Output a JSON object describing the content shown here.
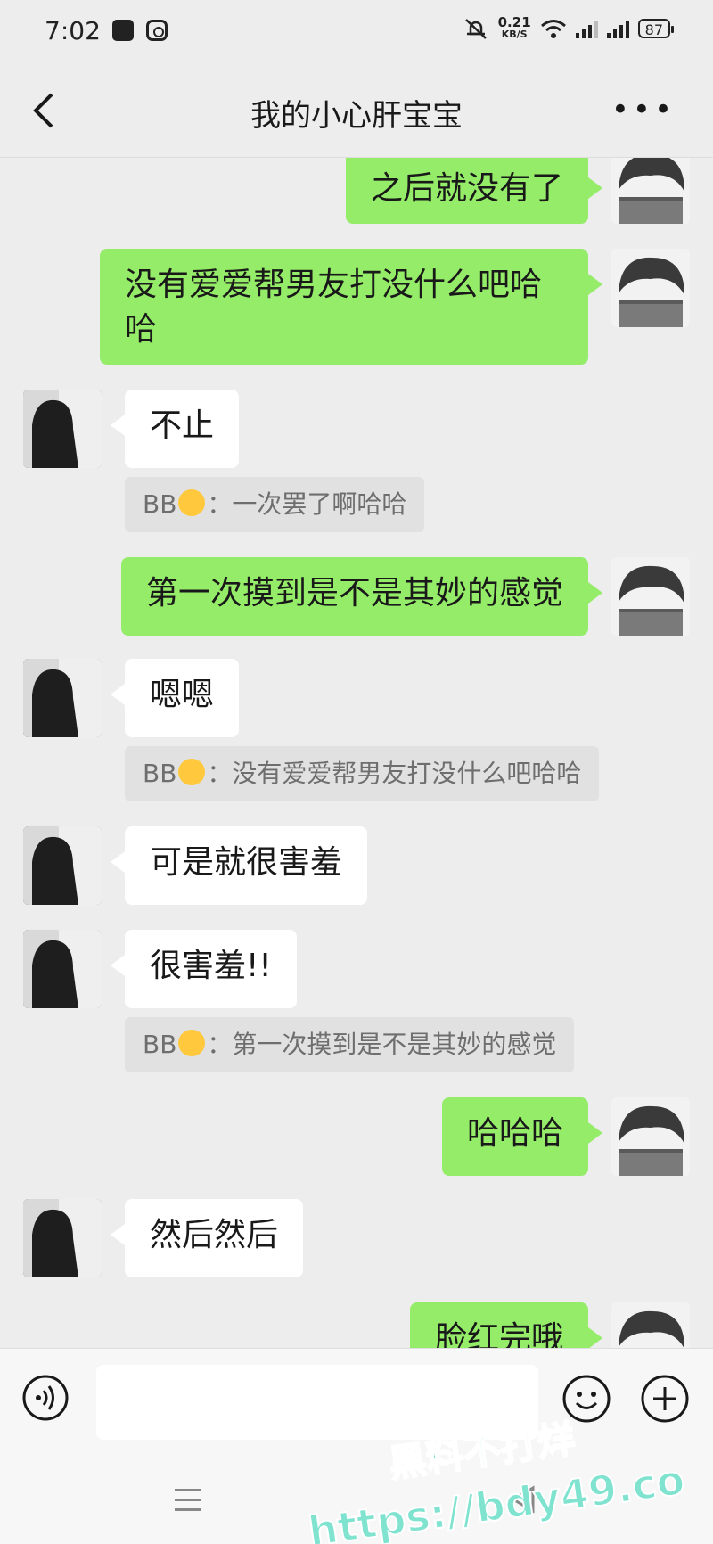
{
  "status_bar": {
    "time": "7:02",
    "net_speed": "0.21",
    "net_unit": "KB/S",
    "battery": "87"
  },
  "header": {
    "title": "我的小心肝宝宝"
  },
  "messages": [
    {
      "side": "me",
      "text": "之后就没有了"
    },
    {
      "side": "me",
      "text_line1": "没有爱爱帮男友打没什么吧哈",
      "text_line2": "哈"
    },
    {
      "side": "her",
      "text": "不止",
      "quote_name": "BB",
      "quote_text": "：一次罢了啊哈哈"
    },
    {
      "side": "me",
      "text": "第一次摸到是不是其妙的感觉"
    },
    {
      "side": "her",
      "text": "嗯嗯",
      "quote_name": "BB",
      "quote_text": "：没有爱爱帮男友打没什么吧哈哈"
    },
    {
      "side": "her",
      "text": "可是就很害羞"
    },
    {
      "side": "her",
      "text": "很害羞!!",
      "quote_name": "BB",
      "quote_text": "：第一次摸到是不是其妙的感觉"
    },
    {
      "side": "me",
      "text": "哈哈哈"
    },
    {
      "side": "her",
      "text": "然后然后"
    },
    {
      "side": "me",
      "text": "脸红完哦"
    }
  ],
  "watermark": {
    "line1": "黑料不打烊",
    "line2": "https://bdy49.co"
  },
  "colors": {
    "sent_bubble": "#95ec69",
    "received_bubble": "#ffffff",
    "background": "#ededed",
    "watermark": "#7fe3cf"
  },
  "icons": [
    "back-icon",
    "more-icon",
    "voice-icon",
    "emoji-icon",
    "plus-icon",
    "nav-menu-icon",
    "nav-back-icon"
  ]
}
